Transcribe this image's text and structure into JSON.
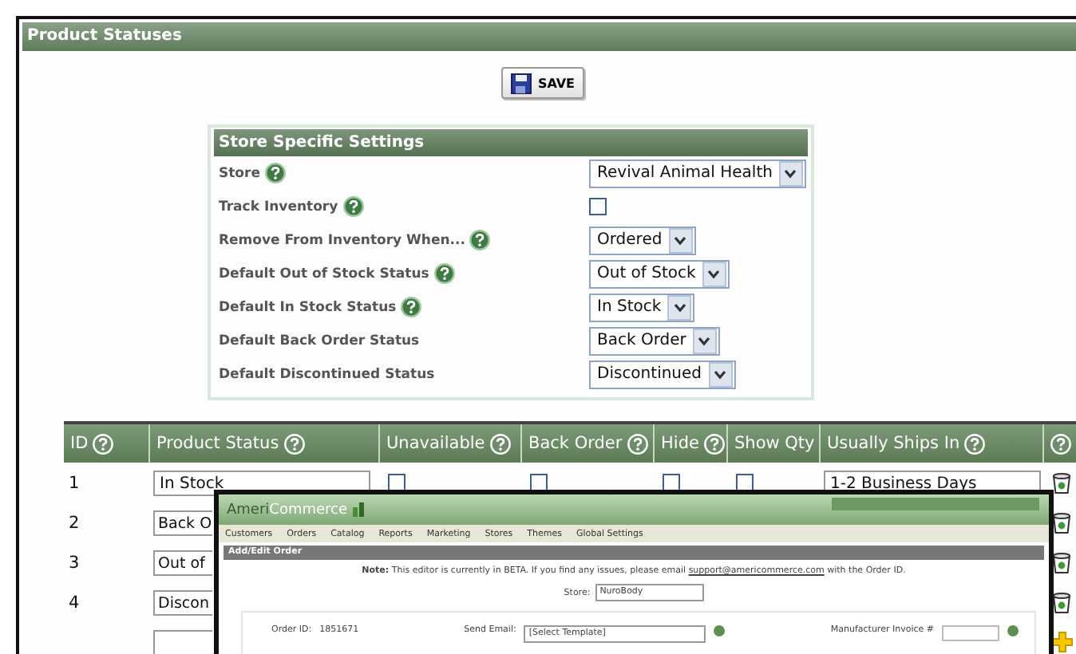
{
  "panel_title": "Product Statuses",
  "save_button": "SAVE",
  "settings": {
    "title": "Store Specific Settings",
    "rows": [
      {
        "label": "Store",
        "help": true,
        "kind": "select",
        "value": "Revival Animal Health"
      },
      {
        "label": "Track Inventory",
        "help": true,
        "kind": "checkbox",
        "checked": false
      },
      {
        "label": "Remove From Inventory When...",
        "help": true,
        "kind": "select",
        "value": "Ordered"
      },
      {
        "label": "Default Out of Stock Status",
        "help": true,
        "kind": "select",
        "value": "Out of Stock"
      },
      {
        "label": "Default In Stock Status",
        "help": true,
        "kind": "select",
        "value": "In Stock"
      },
      {
        "label": "Default Back Order Status",
        "help": false,
        "kind": "select",
        "value": "Back Order"
      },
      {
        "label": "Default Discontinued Status",
        "help": false,
        "kind": "select",
        "value": "Discontinued"
      }
    ]
  },
  "table": {
    "columns": [
      {
        "label": "ID",
        "help": true
      },
      {
        "label": "Product Status",
        "help": true
      },
      {
        "label": "Unavailable",
        "help": true
      },
      {
        "label": "Back Order",
        "help": true
      },
      {
        "label": "Hide",
        "help": true
      },
      {
        "label": "Show Qty",
        "help": false
      },
      {
        "label": "Usually Ships In",
        "help": true
      },
      {
        "help": true
      }
    ],
    "rows": [
      {
        "id": "1",
        "status": "In Stock",
        "unavailable": false,
        "back_order": false,
        "hide": false,
        "show_qty": false,
        "ships_in": "1-2 Business Days"
      },
      {
        "id": "2",
        "status": "Back O"
      },
      {
        "id": "3",
        "status": "Out of"
      },
      {
        "id": "4",
        "status": "Discon"
      }
    ]
  },
  "overlay": {
    "logo_first": "Ameri",
    "logo_second": "Commerce",
    "menu": [
      "Customers",
      "Orders",
      "Catalog",
      "Reports",
      "Marketing",
      "Stores",
      "Themes",
      "Global Settings"
    ],
    "section_title": "Add/Edit Order",
    "note": {
      "lead": "Note:",
      "before": "This editor is currently in BETA. If you find any issues, please email",
      "link": "support@americommerce.com",
      "after": "with the Order ID."
    },
    "store_label": "Store:",
    "store_value": "NuroBody",
    "fields": [
      {
        "label": "Order ID:",
        "kind": "text",
        "value": "1851671"
      },
      {
        "label": "Send Email:",
        "kind": "select",
        "value": "[Select Template]"
      },
      {
        "label": "Manufacturer Invoice #",
        "kind": "input"
      }
    ]
  }
}
